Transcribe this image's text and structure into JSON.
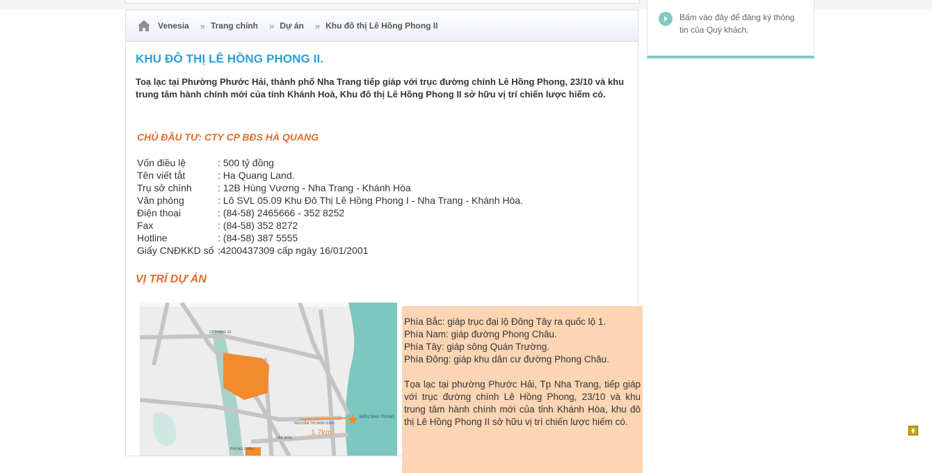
{
  "breadcrumb": {
    "items": [
      "Venesia",
      "Trang chính",
      "Dự án",
      "Khu đô thị Lê Hồng Phong II"
    ]
  },
  "article": {
    "title": "KHU ĐÔ THỊ LÊ HỒNG PHONG II.",
    "intro": "Toạ lạc tại Phường Phước Hải, thành phố Nha Trang tiếp giáp với trục đường chính Lê Hồng Phong, 23/10 và khu trung tâm hành chính mới của tỉnh Khánh Hoà, Khu đô thị Lê Hồng Phong II sở hữu vị trí chiến lược hiếm có.",
    "investor_heading": "CHỦ ĐẦU TƯ: CTY CP BĐS HÀ QUANG",
    "info": [
      {
        "key": "Vốn điều lệ",
        "value": ": 500 tỷ đồng"
      },
      {
        "key": "Tên viết tắt",
        "value": ": Ha Quang Land."
      },
      {
        "key": "Trụ sở chính",
        "value": ": 12B Hùng Vương - Nha Trang - Khánh Hòa"
      },
      {
        "key": "Văn phòng",
        "value": ": Lô SVL 05.09 Khu Đô Thị Lê Hồng Phong I - Nha Trang - Khánh Hòa."
      },
      {
        "key": "Điện thoại",
        "value": ": (84-58) 2465666 - 352 8252"
      },
      {
        "key": "Fax",
        "value": ": (84-58) 352 8272"
      },
      {
        "key": "Hotline",
        "value": ": (84-58) 387 5555"
      },
      {
        "key": "Giấy CNĐKKD số",
        "value": " :4200437309 cấp ngày 16/01/2001"
      }
    ],
    "location_heading": "VỊ TRÍ DỰ ÁN",
    "location_lines": [
      "Phía Bắc: giáp trục đại lộ Đông Tây ra quốc lộ 1.",
      "Phía Nam: giáp đường Phong Châu.",
      "Phía Tây: giáp sông Quán Trường.",
      "Phía Đông: giáp khu dân cư đường Phong Châu."
    ],
    "location_paragraph": "Tọa lạc tại phường Phước Hải, Tp Nha Trang, tiếp giáp với trục đường chính Lê Hồng Phong, 23/10 và khu trung tâm hành chính mới của tỉnh Khánh Hòa, khu đô thị Lê Hồng Phong II sở hữu vị trí chiến lược hiếm có.",
    "map_labels": {
      "sea": "BIỂN NHA TRANG",
      "distance": "1.7km",
      "road1": "NGUYỄN THỊ MINH KHAI",
      "road2": "23 THÁNG 10",
      "road3": "PHONG CHÂU",
      "road4": "VÂN ĐỒN"
    }
  },
  "register": {
    "text": "Bấm vào đây để đăng ký thông tin của Quý khách."
  },
  "colors": {
    "title": "#29a0d3",
    "heading_orange": "#e36b29",
    "sidebox_bg": "#fcd5b4",
    "map_orange": "#f28a2e",
    "sea": "#7cc7bf",
    "accent_teal": "#7fcbc4"
  }
}
